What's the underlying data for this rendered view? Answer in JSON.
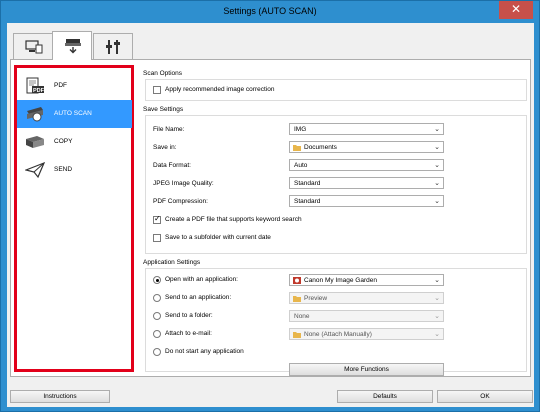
{
  "window": {
    "title": "Settings (AUTO SCAN)",
    "close_glyph": "✕"
  },
  "tabs": [
    {
      "icon": "scan-from-computer-icon",
      "active": false
    },
    {
      "icon": "scan-from-operation-panel-icon",
      "active": true
    },
    {
      "icon": "general-settings-icon",
      "active": false
    }
  ],
  "sidebar": {
    "items": [
      {
        "label": "PDF",
        "icon": "pdf-icon",
        "selected": false
      },
      {
        "label": "AUTO SCAN",
        "icon": "auto-scan-icon",
        "selected": true
      },
      {
        "label": "COPY",
        "icon": "copy-icon",
        "selected": false
      },
      {
        "label": "SEND",
        "icon": "send-icon",
        "selected": false
      }
    ]
  },
  "scan_options": {
    "title": "Scan Options",
    "apply_correction": {
      "label": "Apply recommended image correction",
      "checked": false
    }
  },
  "save_settings": {
    "title": "Save Settings",
    "file_name": {
      "label": "File Name:",
      "value": "IMG"
    },
    "save_in": {
      "label": "Save in:",
      "value": "Documents",
      "icon": "folder-icon"
    },
    "data_format": {
      "label": "Data Format:",
      "value": "Auto"
    },
    "jpeg_quality": {
      "label": "JPEG Image Quality:",
      "value": "Standard"
    },
    "pdf_compression": {
      "label": "PDF Compression:",
      "value": "Standard"
    },
    "keyword_pdf": {
      "label": "Create a PDF file that supports keyword search",
      "checked": true
    },
    "subfolder": {
      "label": "Save to a subfolder with current date",
      "checked": false
    }
  },
  "application_settings": {
    "title": "Application Settings",
    "open_with": {
      "label": "Open with an application:",
      "selected": true,
      "value": "Canon My Image Garden",
      "icon": "image-garden-icon"
    },
    "send_to_app": {
      "label": "Send to an application:",
      "selected": false,
      "value": "Preview",
      "icon": "preview-app-icon"
    },
    "send_to_folder": {
      "label": "Send to a folder:",
      "selected": false,
      "value": "None"
    },
    "attach_email": {
      "label": "Attach to e-mail:",
      "selected": false,
      "value": "None (Attach Manually)",
      "icon": "email-icon"
    },
    "do_not_start": {
      "label": "Do not start any application",
      "selected": false
    },
    "more_functions": "More Functions"
  },
  "footer": {
    "instructions": "Instructions",
    "defaults": "Defaults",
    "ok": "OK"
  },
  "colors": {
    "titlebar": "#2e8fcf",
    "close": "#c7504a",
    "selection": "#3399ff",
    "highlight_border": "#e2001a"
  }
}
